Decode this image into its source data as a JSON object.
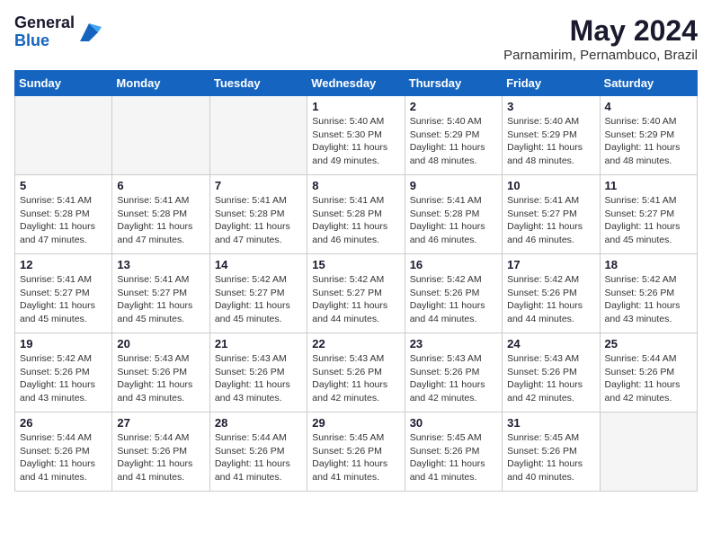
{
  "logo": {
    "general": "General",
    "blue": "Blue"
  },
  "title": {
    "month_year": "May 2024",
    "location": "Parnamirim, Pernambuco, Brazil"
  },
  "days_of_week": [
    "Sunday",
    "Monday",
    "Tuesday",
    "Wednesday",
    "Thursday",
    "Friday",
    "Saturday"
  ],
  "weeks": [
    [
      {
        "day": "",
        "empty": true
      },
      {
        "day": "",
        "empty": true
      },
      {
        "day": "",
        "empty": true
      },
      {
        "day": "1",
        "sunrise": "5:40 AM",
        "sunset": "5:30 PM",
        "daylight": "11 hours and 49 minutes."
      },
      {
        "day": "2",
        "sunrise": "5:40 AM",
        "sunset": "5:29 PM",
        "daylight": "11 hours and 48 minutes."
      },
      {
        "day": "3",
        "sunrise": "5:40 AM",
        "sunset": "5:29 PM",
        "daylight": "11 hours and 48 minutes."
      },
      {
        "day": "4",
        "sunrise": "5:40 AM",
        "sunset": "5:29 PM",
        "daylight": "11 hours and 48 minutes."
      }
    ],
    [
      {
        "day": "5",
        "sunrise": "5:41 AM",
        "sunset": "5:28 PM",
        "daylight": "11 hours and 47 minutes."
      },
      {
        "day": "6",
        "sunrise": "5:41 AM",
        "sunset": "5:28 PM",
        "daylight": "11 hours and 47 minutes."
      },
      {
        "day": "7",
        "sunrise": "5:41 AM",
        "sunset": "5:28 PM",
        "daylight": "11 hours and 47 minutes."
      },
      {
        "day": "8",
        "sunrise": "5:41 AM",
        "sunset": "5:28 PM",
        "daylight": "11 hours and 46 minutes."
      },
      {
        "day": "9",
        "sunrise": "5:41 AM",
        "sunset": "5:28 PM",
        "daylight": "11 hours and 46 minutes."
      },
      {
        "day": "10",
        "sunrise": "5:41 AM",
        "sunset": "5:27 PM",
        "daylight": "11 hours and 46 minutes."
      },
      {
        "day": "11",
        "sunrise": "5:41 AM",
        "sunset": "5:27 PM",
        "daylight": "11 hours and 45 minutes."
      }
    ],
    [
      {
        "day": "12",
        "sunrise": "5:41 AM",
        "sunset": "5:27 PM",
        "daylight": "11 hours and 45 minutes."
      },
      {
        "day": "13",
        "sunrise": "5:41 AM",
        "sunset": "5:27 PM",
        "daylight": "11 hours and 45 minutes."
      },
      {
        "day": "14",
        "sunrise": "5:42 AM",
        "sunset": "5:27 PM",
        "daylight": "11 hours and 45 minutes."
      },
      {
        "day": "15",
        "sunrise": "5:42 AM",
        "sunset": "5:27 PM",
        "daylight": "11 hours and 44 minutes."
      },
      {
        "day": "16",
        "sunrise": "5:42 AM",
        "sunset": "5:26 PM",
        "daylight": "11 hours and 44 minutes."
      },
      {
        "day": "17",
        "sunrise": "5:42 AM",
        "sunset": "5:26 PM",
        "daylight": "11 hours and 44 minutes."
      },
      {
        "day": "18",
        "sunrise": "5:42 AM",
        "sunset": "5:26 PM",
        "daylight": "11 hours and 43 minutes."
      }
    ],
    [
      {
        "day": "19",
        "sunrise": "5:42 AM",
        "sunset": "5:26 PM",
        "daylight": "11 hours and 43 minutes."
      },
      {
        "day": "20",
        "sunrise": "5:43 AM",
        "sunset": "5:26 PM",
        "daylight": "11 hours and 43 minutes."
      },
      {
        "day": "21",
        "sunrise": "5:43 AM",
        "sunset": "5:26 PM",
        "daylight": "11 hours and 43 minutes."
      },
      {
        "day": "22",
        "sunrise": "5:43 AM",
        "sunset": "5:26 PM",
        "daylight": "11 hours and 42 minutes."
      },
      {
        "day": "23",
        "sunrise": "5:43 AM",
        "sunset": "5:26 PM",
        "daylight": "11 hours and 42 minutes."
      },
      {
        "day": "24",
        "sunrise": "5:43 AM",
        "sunset": "5:26 PM",
        "daylight": "11 hours and 42 minutes."
      },
      {
        "day": "25",
        "sunrise": "5:44 AM",
        "sunset": "5:26 PM",
        "daylight": "11 hours and 42 minutes."
      }
    ],
    [
      {
        "day": "26",
        "sunrise": "5:44 AM",
        "sunset": "5:26 PM",
        "daylight": "11 hours and 41 minutes."
      },
      {
        "day": "27",
        "sunrise": "5:44 AM",
        "sunset": "5:26 PM",
        "daylight": "11 hours and 41 minutes."
      },
      {
        "day": "28",
        "sunrise": "5:44 AM",
        "sunset": "5:26 PM",
        "daylight": "11 hours and 41 minutes."
      },
      {
        "day": "29",
        "sunrise": "5:45 AM",
        "sunset": "5:26 PM",
        "daylight": "11 hours and 41 minutes."
      },
      {
        "day": "30",
        "sunrise": "5:45 AM",
        "sunset": "5:26 PM",
        "daylight": "11 hours and 41 minutes."
      },
      {
        "day": "31",
        "sunrise": "5:45 AM",
        "sunset": "5:26 PM",
        "daylight": "11 hours and 40 minutes."
      },
      {
        "day": "",
        "empty": true
      }
    ]
  ]
}
